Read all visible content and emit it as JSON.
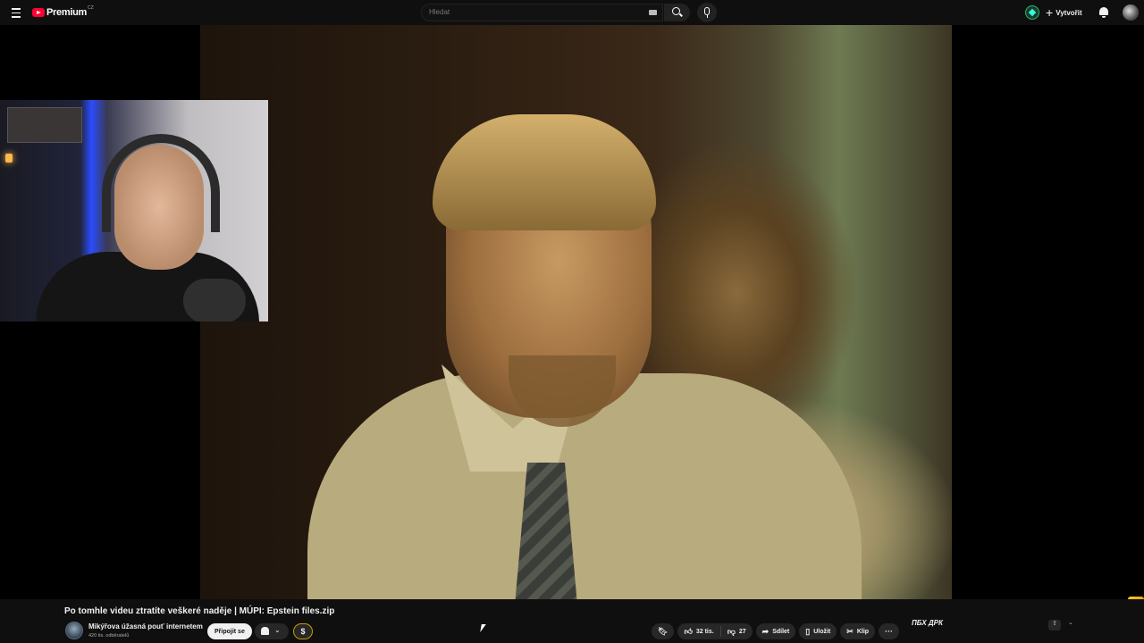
{
  "header": {
    "logo_text": "Premium",
    "logo_country": "CZ",
    "search_placeholder": "Hledat",
    "create_label": "Vytvořit"
  },
  "video": {
    "title": "Po tomhle videu ztratíte veškeré naděje | MÚPI: Epstein files.zip"
  },
  "channel": {
    "name": "Mikýřova úžasná pouť internetem",
    "subscribers": "420 tis. odběratelů",
    "join_label": "Připojit se",
    "tip_label": "$"
  },
  "actions": {
    "likes": "32 tis.",
    "dislikes": "27",
    "share_label": "Sdílet",
    "save_label": "Uložit",
    "clip_label": "Klip",
    "more_label": "···"
  },
  "side": {
    "logo_text": "ПБХ ДРК"
  },
  "icons": {
    "menu": "menu-icon",
    "search": "search-icon",
    "mic": "mic-icon",
    "bell": "bell-icon",
    "bookmark": "bookmark-icon",
    "like": "thumbs-up-icon",
    "dislike": "thumbs-down-icon",
    "share": "share-icon",
    "save": "save-icon",
    "clip": "scissors-icon"
  },
  "colors": {
    "brand_red": "#ff0033",
    "background": "#0f0f0f",
    "tip_border": "#c89b00"
  }
}
